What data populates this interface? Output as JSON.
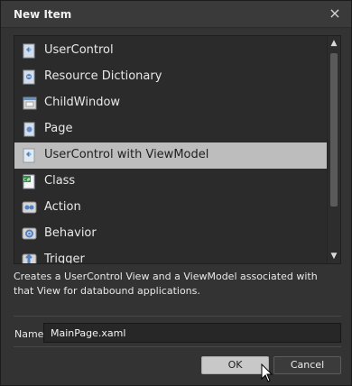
{
  "dialog": {
    "title": "New Item",
    "close_symbol": "×"
  },
  "items": [
    {
      "label": "UserControl",
      "icon": "usercontrol-icon",
      "selected": false
    },
    {
      "label": "Resource Dictionary",
      "icon": "resource-dictionary-icon",
      "selected": false
    },
    {
      "label": "ChildWindow",
      "icon": "childwindow-icon",
      "selected": false
    },
    {
      "label": "Page",
      "icon": "page-icon",
      "selected": false
    },
    {
      "label": "UserControl with ViewModel",
      "icon": "usercontrol-viewmodel-icon",
      "selected": true
    },
    {
      "label": "Class",
      "icon": "class-icon",
      "selected": false
    },
    {
      "label": "Action",
      "icon": "action-icon",
      "selected": false
    },
    {
      "label": "Behavior",
      "icon": "behavior-icon",
      "selected": false
    },
    {
      "label": "Trigger",
      "icon": "trigger-icon",
      "selected": false
    }
  ],
  "description": "Creates a UserControl View and a ViewModel associated with that View for databound applications.",
  "name_field": {
    "label": "Name",
    "value": "MainPage.xaml"
  },
  "buttons": {
    "ok": "OK",
    "cancel": "Cancel"
  },
  "scrollbar": {
    "up": "▲",
    "down": "▼"
  },
  "colors": {
    "background": "#333333",
    "list_background": "#2b2b2b",
    "selected": "#bdbdbd",
    "text": "#e8e8e8"
  }
}
